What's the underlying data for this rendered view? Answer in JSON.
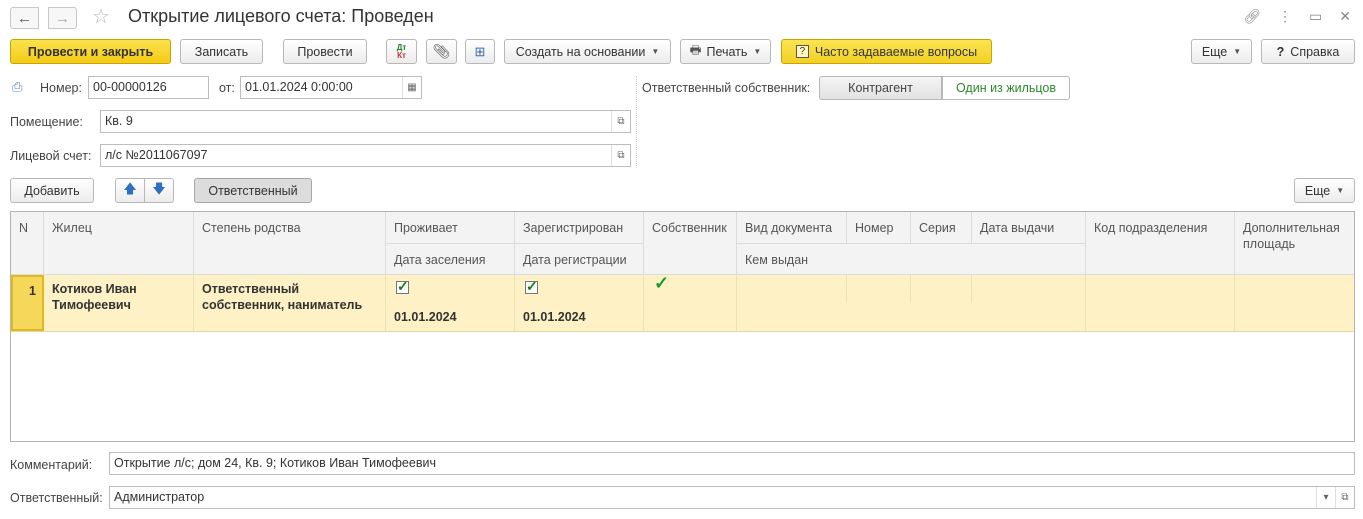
{
  "window": {
    "title": "Открытие лицевого счета: Проведен"
  },
  "toolbar": {
    "post_close": "Провести и закрыть",
    "save": "Записать",
    "post": "Провести",
    "dt_kt": "Дт Кт",
    "create_based": "Создать на основании",
    "print": "Печать",
    "faq": "Часто задаваемые вопросы",
    "more": "Еще",
    "help": "Справка"
  },
  "form": {
    "number_label": "Номер:",
    "number_value": "00-00000126",
    "date_label": "от:",
    "date_value": "01.01.2024  0:00:00",
    "premises_label": "Помещение:",
    "premises_value": "Кв. 9",
    "account_label": "Лицевой счет:",
    "account_value": "л/с №2011067097",
    "owner_label": "Ответственный собственник:",
    "owner_option_counterparty": "Контрагент",
    "owner_option_resident": "Один из жильцов"
  },
  "table_toolbar": {
    "add": "Добавить",
    "responsible": "Ответственный",
    "more": "Еще"
  },
  "table": {
    "headers": {
      "n": "N",
      "resident": "Жилец",
      "kinship": "Степень родства",
      "lives": "Проживает",
      "move_in": "Дата заселения",
      "registered": "Зарегистрирован",
      "reg_date": "Дата регистрации",
      "owner": "Собственник",
      "doc_type": "Вид документа",
      "number": "Номер",
      "series": "Серия",
      "issue_date": "Дата выдачи",
      "issued_by": "Кем выдан",
      "dept_code": "Код подразделения",
      "extra_area": "Дополнительная площадь"
    },
    "rows": [
      {
        "n": "1",
        "resident": "Котиков Иван Тимофеевич",
        "kinship": "Ответственный собственник, наниматель",
        "lives": true,
        "move_in": "01.01.2024",
        "registered": true,
        "reg_date": "01.01.2024",
        "owner": true
      }
    ]
  },
  "footer": {
    "comment_label": "Комментарий:",
    "comment_value": "Открытие л/с; дом 24, Кв. 9; Котиков Иван Тимофеевич",
    "responsible_label": "Ответственный:",
    "responsible_value": "Администратор"
  },
  "colors": {
    "primary_button": "#f4cc17",
    "selected_row": "#fdf1c5",
    "accent_green": "#2a8a2a"
  }
}
